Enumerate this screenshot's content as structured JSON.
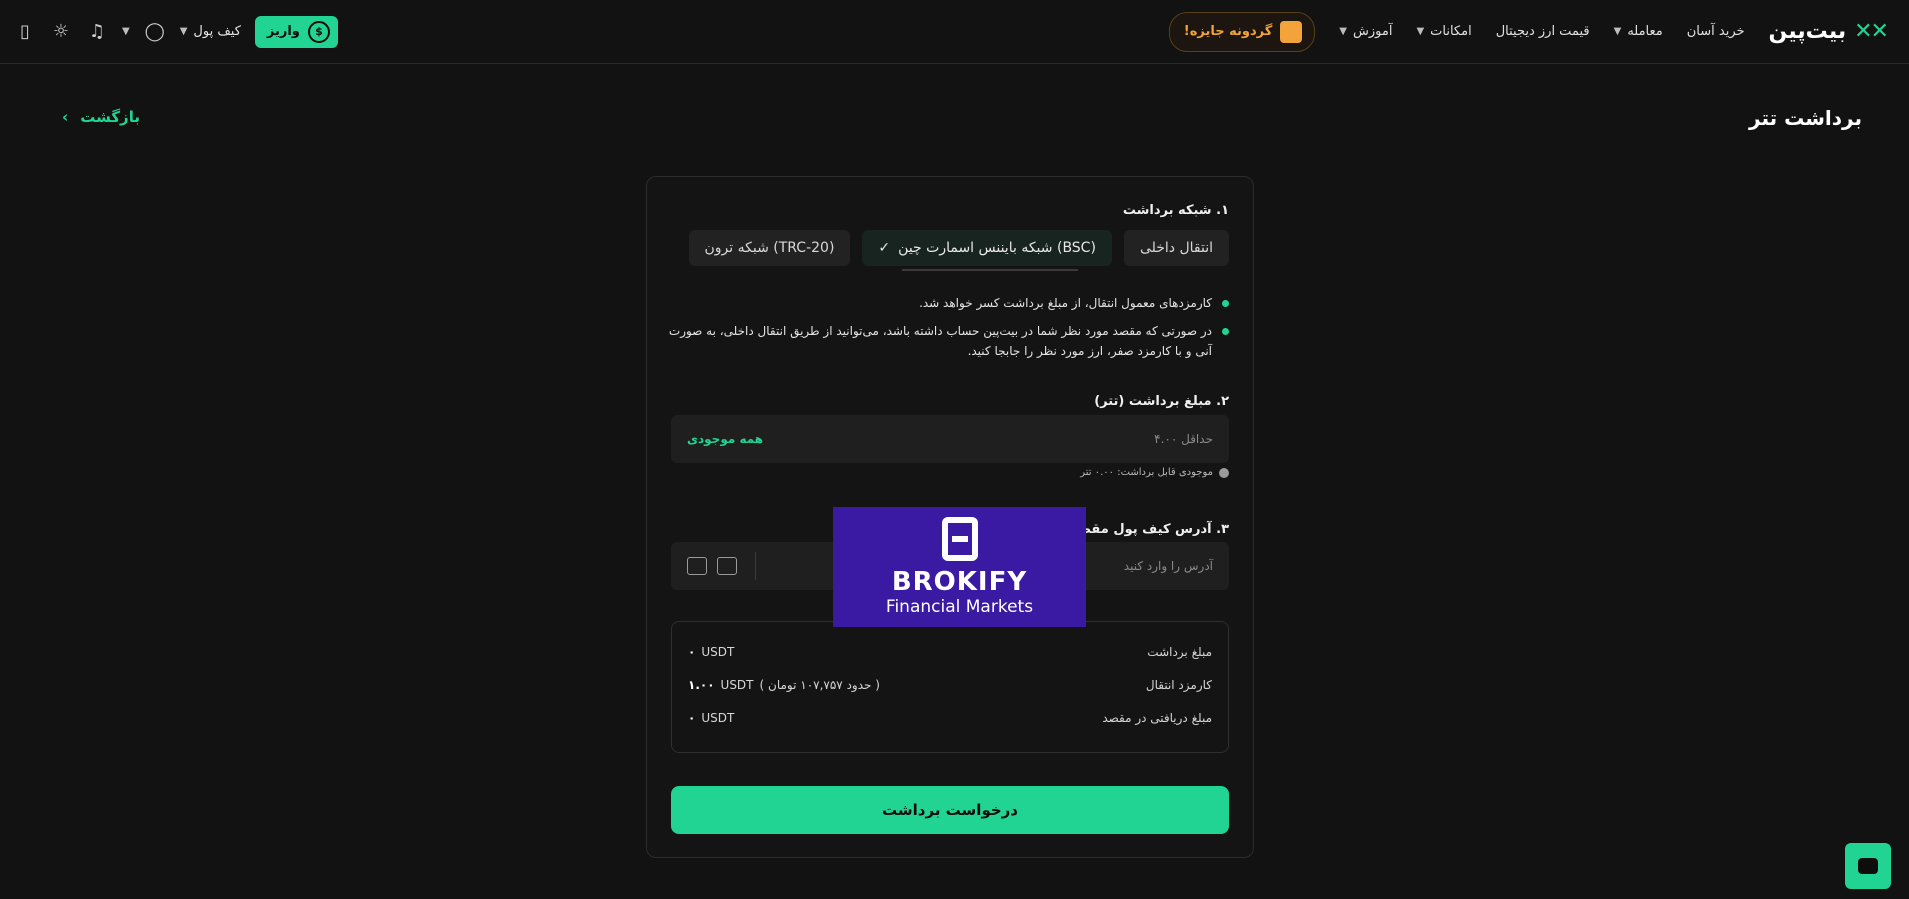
{
  "header": {
    "logo_text": "بیت‌پین",
    "nav": [
      "خرید آسان",
      "معامله",
      "قیمت ارز دیجیتال",
      "امکانات",
      "آموزش"
    ],
    "prize_label": "گردونه جایزه!",
    "deposit_label": "واریز",
    "wallet_label": "کیف پول"
  },
  "page": {
    "title": "برداشت تتر",
    "back_label": "بازگشت"
  },
  "network": {
    "label": "۱. شبکه برداشت",
    "options": [
      "انتقال داخلی",
      "(BSC) شبکه بایننس اسمارت چین",
      "(TRC-20) شبکه ترون"
    ],
    "selected_index": 1
  },
  "notes": [
    "کارمزدهای معمول انتقال، از مبلغ برداشت کسر خواهد شد.",
    "در صورتی که مقصد مورد نظر شما در بیت‌پین حساب داشته باشد، می‌توانید از طریق انتقال داخلی، به صورت آنی و با کارمزد صفر، ارز مورد نظر را جابجا کنید."
  ],
  "amount": {
    "label": "۲. مبلغ برداشت (تتر)",
    "placeholder": "حداقل ۴.۰۰",
    "all_balance_label": "همه موجودی",
    "available_label": "موجودی قابل برداشت: ۰.۰۰ تتر"
  },
  "address": {
    "label": "۳. آدرس کیف پول مقصد",
    "placeholder": "آدرس را وارد کنید"
  },
  "summary": {
    "withdraw_label": "مبلغ برداشت",
    "withdraw_value": "USDT",
    "withdraw_number": "۰",
    "fee_label": "کارمزد انتقال",
    "fee_value": "USDT",
    "fee_number": "۱.۰۰",
    "fee_note": "( حدود ۱۰۷,۷۵۷ تومان )",
    "receive_label": "مبلغ دریافتی در مقصد",
    "receive_value": "USDT",
    "receive_number": "۰"
  },
  "submit_label": "درخواست برداشت",
  "overlay": {
    "name": "BROKIFY",
    "sub": "Financial Markets"
  },
  "colors": {
    "accent": "#22d493",
    "background": "#121212",
    "prize": "#f2a33a",
    "overlay": "#3b1aa3"
  }
}
